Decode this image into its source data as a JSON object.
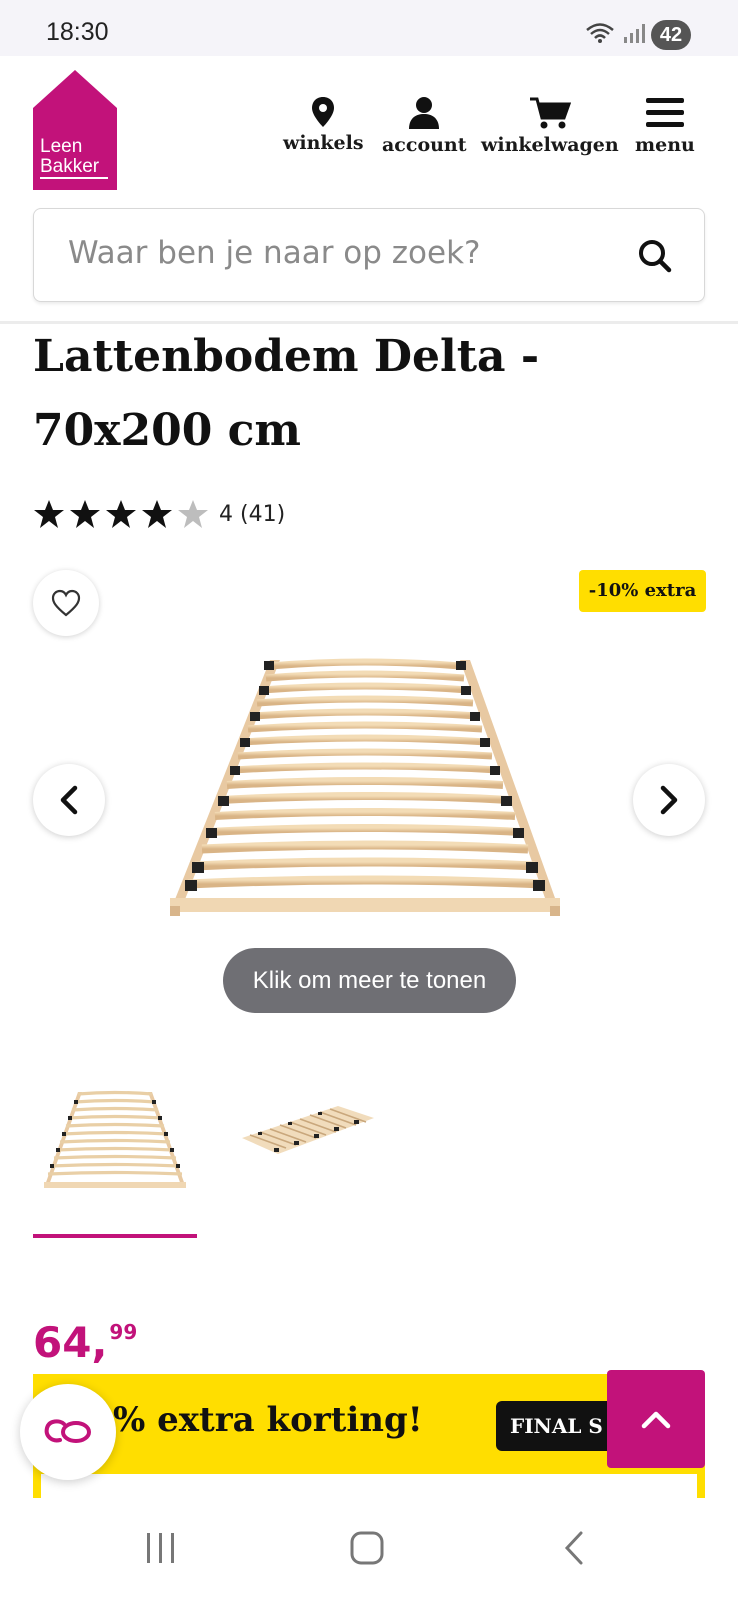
{
  "status_bar": {
    "time": "18:30",
    "battery": "42"
  },
  "header": {
    "logo_text": [
      "Leen",
      "Bakker"
    ],
    "nav": [
      {
        "label": "winkels",
        "icon": "location-pin-icon"
      },
      {
        "label": "account",
        "icon": "user-icon"
      },
      {
        "label": "winkelwagen",
        "icon": "shopping-cart-icon"
      },
      {
        "label": "menu",
        "icon": "hamburger-menu-icon"
      }
    ],
    "search": {
      "placeholder": "Waar ben je naar op zoek?"
    }
  },
  "product": {
    "title": "Lattenbodem Delta - 70x200 cm",
    "rating": {
      "value": 4,
      "max": 5,
      "text": "4 (41)"
    },
    "promo_badge": "-10% extra",
    "show_more": "Klik om meer te tonen",
    "price": {
      "main": "64,",
      "cents": "99"
    }
  },
  "promo_banner": {
    "text": "% extra korting!",
    "tag": "FINAL S"
  },
  "colors": {
    "brand": "#c2127a",
    "promo_yellow": "#ffde00",
    "text": "#111111"
  }
}
